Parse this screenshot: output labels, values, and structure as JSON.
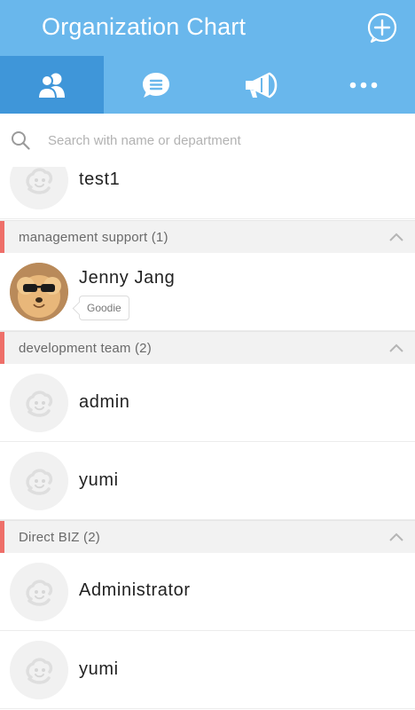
{
  "header": {
    "title": "Organization Chart",
    "add_icon": "add-circle-icon"
  },
  "tabs": [
    {
      "name": "members",
      "icon": "people-icon",
      "active": true
    },
    {
      "name": "chats",
      "icon": "chat-bubble-icon",
      "active": false
    },
    {
      "name": "announcements",
      "icon": "megaphone-icon",
      "active": false
    },
    {
      "name": "more",
      "icon": "more-dots-icon",
      "active": false
    }
  ],
  "search": {
    "placeholder": "Search with name or department",
    "value": ""
  },
  "list": {
    "top_members": [
      {
        "name": "test1",
        "avatar": "default-avatar"
      }
    ],
    "groups": [
      {
        "label": "management support (1)",
        "expanded": true,
        "members": [
          {
            "name": "Jenny Jang",
            "avatar": "photo-dog-sunglasses",
            "status": "Goodie"
          }
        ]
      },
      {
        "label": "development team (2)",
        "expanded": true,
        "members": [
          {
            "name": "admin",
            "avatar": "default-avatar"
          },
          {
            "name": "yumi",
            "avatar": "default-avatar"
          }
        ]
      },
      {
        "label": "Direct BIZ (2)",
        "expanded": true,
        "members": [
          {
            "name": "Administrator",
            "avatar": "default-avatar"
          },
          {
            "name": "yumi",
            "avatar": "default-avatar"
          }
        ]
      }
    ]
  },
  "colors": {
    "header": "#69b7ec",
    "active_tab": "#3f96d9",
    "group_accent": "#ee6f69",
    "group_bg": "#f2f2f2"
  }
}
